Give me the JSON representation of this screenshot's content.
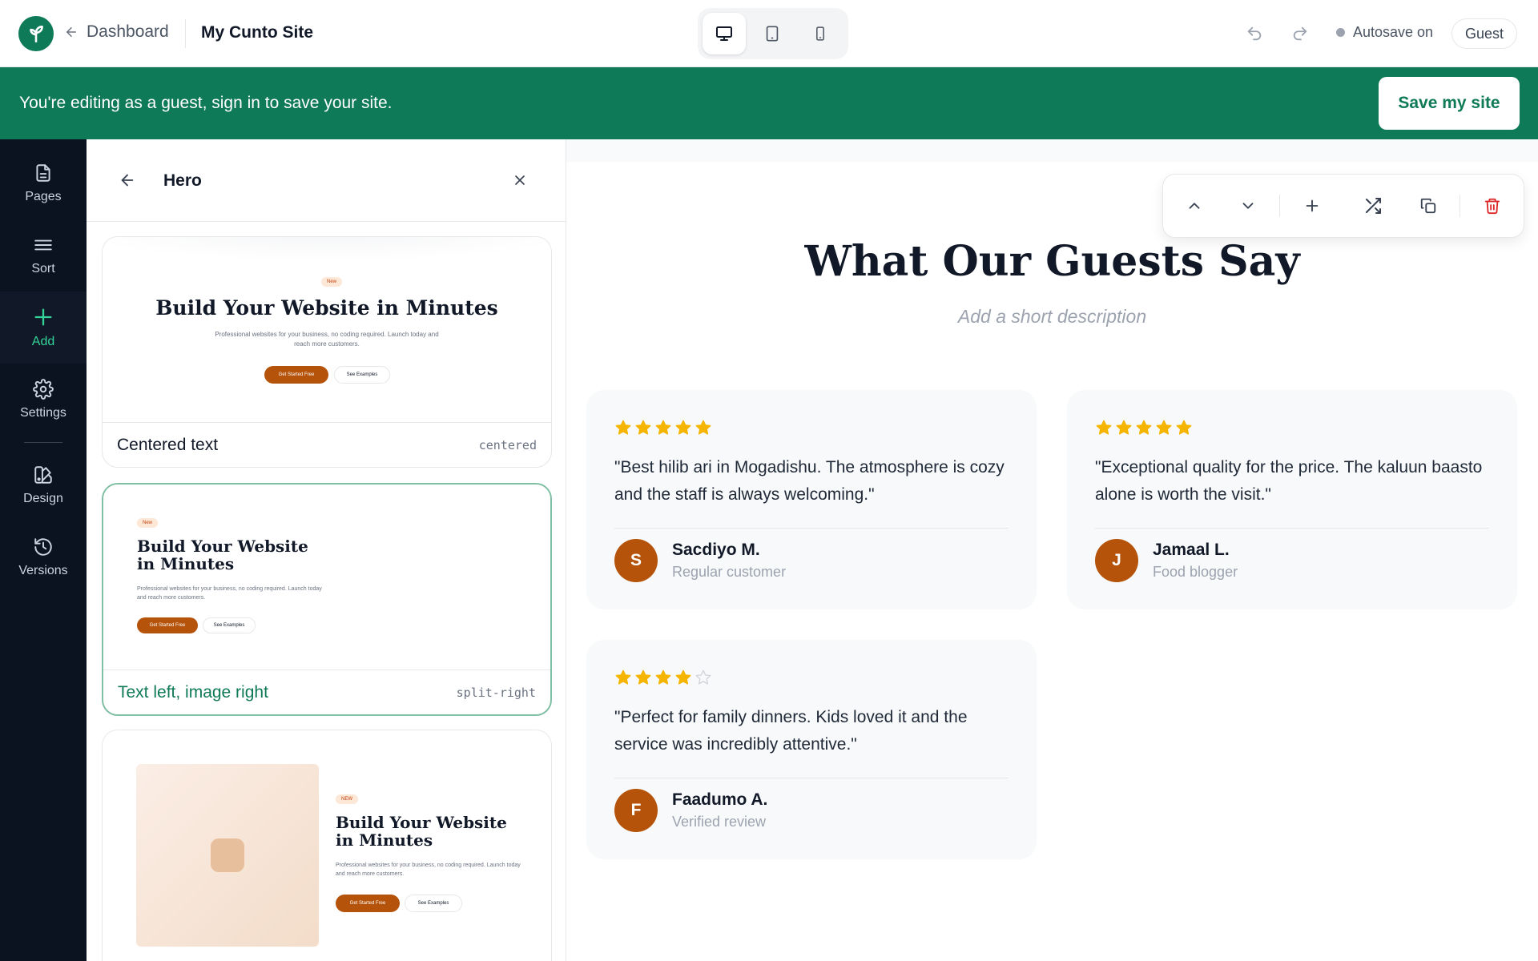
{
  "topbar": {
    "back_label": "Dashboard",
    "site_name": "My Cunto Site",
    "devices": [
      {
        "name": "desktop-icon",
        "active": true
      },
      {
        "name": "tablet-icon",
        "active": false
      },
      {
        "name": "mobile-icon",
        "active": false
      }
    ],
    "autosave_label": "Autosave on",
    "guest_label": "Guest"
  },
  "banner": {
    "text": "You're editing as a guest, sign in to save your site.",
    "save_label": "Save my site"
  },
  "rail": {
    "items": [
      {
        "label": "Pages",
        "icon": "file-icon",
        "active": false
      },
      {
        "label": "Sort",
        "icon": "menu-icon",
        "active": false
      },
      {
        "label": "Add",
        "icon": "plus-icon",
        "active": true
      },
      {
        "label": "Settings",
        "icon": "gear-icon",
        "active": false
      },
      {
        "label": "Design",
        "icon": "palette-icon",
        "active": false
      },
      {
        "label": "Versions",
        "icon": "history-icon",
        "active": false
      }
    ]
  },
  "panel": {
    "title": "Hero",
    "layouts": [
      {
        "label": "Centered text",
        "code": "centered",
        "selected": false,
        "preview": {
          "badge": "New",
          "title": "Build Your Website in Minutes",
          "desc": "Professional websites for your business, no coding required. Launch today and reach more customers.",
          "primary": "Get Started Free",
          "secondary": "See Examples"
        }
      },
      {
        "label": "Text left, image right",
        "code": "split-right",
        "selected": true,
        "preview": {
          "badge": "New",
          "title": "Build Your Website in Minutes",
          "desc": "Professional websites for your business, no coding required. Launch today and reach more customers.",
          "primary": "Get Started Free",
          "secondary": "See Examples"
        }
      },
      {
        "preview": {
          "badge": "NEW",
          "title": "Build Your Website in Minutes",
          "desc": "Professional websites for your business, no coding required. Launch today and reach more customers.",
          "primary": "Get Started Free",
          "secondary": "See Examples"
        }
      }
    ]
  },
  "canvas": {
    "toolbar": [
      "chevron-up-icon",
      "chevron-down-icon",
      "plus-icon",
      "shuffle-icon",
      "copy-icon",
      "trash-icon"
    ],
    "section_title": "What Our Guests Say",
    "section_desc": "Add a short description",
    "reviews": [
      {
        "rating": 5,
        "quote": "\"Best hilib ari in Mogadishu. The atmosphere is cozy and the staff is always welcoming.\"",
        "initial": "S",
        "name": "Sacdiyo M.",
        "role": "Regular customer"
      },
      {
        "rating": 5,
        "quote": "\"Exceptional quality for the price. The kaluun baasto alone is worth the visit.\"",
        "initial": "J",
        "name": "Jamaal L.",
        "role": "Food blogger"
      },
      {
        "rating": 4,
        "quote": "\"Perfect for family dinners. Kids loved it and the service was incredibly attentive.\"",
        "initial": "F",
        "name": "Faadumo A.",
        "role": "Verified review"
      }
    ]
  },
  "colors": {
    "brand": "#0f7a57",
    "accent": "#b45309",
    "star": "#f5b400",
    "danger": "#dc2626"
  }
}
